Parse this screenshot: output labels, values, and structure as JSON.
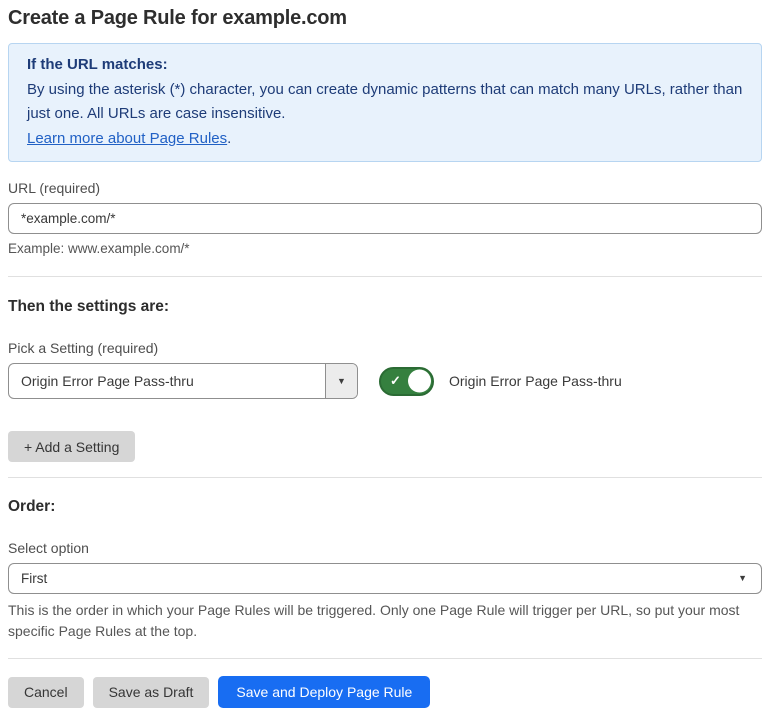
{
  "title": "Create a Page Rule for example.com",
  "notice": {
    "heading": "If the URL matches:",
    "body": "By using the asterisk (*) character, you can create dynamic patterns that can match many URLs, rather than just one. All URLs are case insensitive.",
    "link_text": "Learn more about Page Rules",
    "after_link": "."
  },
  "url_field": {
    "label": "URL (required)",
    "value": "*example.com/*",
    "hint": "Example: www.example.com/*"
  },
  "settings": {
    "heading": "Then the settings are:",
    "picker_label": "Pick a Setting (required)",
    "picker_value": "Origin Error Page Pass-thru",
    "toggle": {
      "state": "on",
      "label": "Origin Error Page Pass-thru"
    },
    "add_button_label": "+ Add a Setting"
  },
  "order": {
    "heading": "Order:",
    "select_label": "Select option",
    "select_value": "First",
    "help_text": "This is the order in which your Page Rules will be triggered. Only one Page Rule will trigger per URL, so put your most specific Page Rules at the top."
  },
  "actions": {
    "cancel_label": "Cancel",
    "save_draft_label": "Save as Draft",
    "save_deploy_label": "Save and Deploy Page Rule"
  },
  "icons": {
    "check": "✓",
    "caret_down": "▼"
  },
  "colors": {
    "notice_bg": "#e8f2fc",
    "notice_border": "#b7d5f1",
    "notice_text": "#1e3c78",
    "link_blue": "#2161c5",
    "toggle_on_green": "#35803f",
    "primary_button_blue": "#186df2",
    "secondary_button_gray": "#d6d6d6"
  }
}
